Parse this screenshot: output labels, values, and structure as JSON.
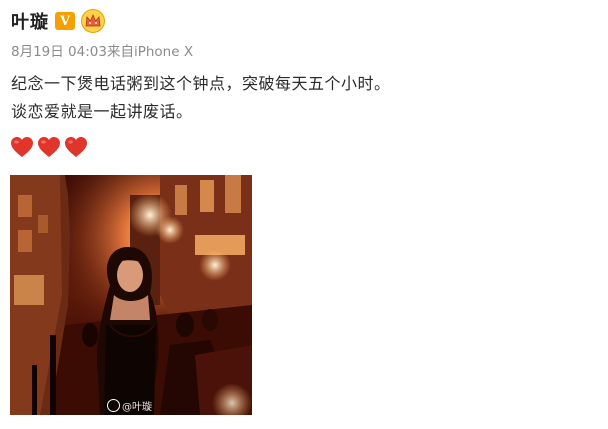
{
  "user": {
    "name": "叶璇",
    "verified_badge": "V",
    "verified_icon": "verified-v-icon",
    "member_icon": "vip-crown-icon"
  },
  "post": {
    "timestamp": "8月19日 04:03",
    "source": "来自iPhone X",
    "lines": [
      "纪念一下煲电话粥到这个钟点，突破每天五个小时。",
      "谈恋爱就是一起讲废话。"
    ],
    "hearts": [
      "heart-icon",
      "heart-icon",
      "heart-icon"
    ],
    "photo": {
      "description_icon": "photo-thumbnail",
      "watermark": "@叶璇"
    }
  },
  "colors": {
    "name": "#222222",
    "meta": "#8b8b8b",
    "heart": "#e0352b",
    "vip": "#f4a000"
  }
}
